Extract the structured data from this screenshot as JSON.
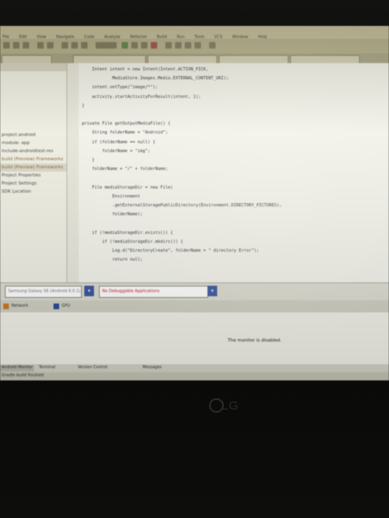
{
  "device": {
    "brand": "LG"
  },
  "ide": {
    "menu": [
      "File",
      "Edit",
      "View",
      "Navigate",
      "Code",
      "Analyze",
      "Refactor",
      "Build",
      "Run",
      "Tools",
      "VCS",
      "Window",
      "Help"
    ],
    "project_tree": [
      "project.android",
      "module: app",
      "include-androidtest-res",
      "build (Preview) Frameworks",
      "build (Preview) Frameworks",
      "Project Properties",
      "Project Settings",
      "SDK Location"
    ],
    "code_lines": [
      "    Intent intent = new Intent(Intent.ACTION_PICK,",
      "            MediaStore.Images.Media.EXTERNAL_CONTENT_URI);",
      "    intent.setType(\"image/*\");",
      "    activity.startActivityForResult(intent, 1);",
      "}",
      "",
      "private File getOutputMediaFile() {",
      "    String folderName = \"Android\";",
      "    if (folderName == null) {",
      "        folderName = \"img\";",
      "    }",
      "    folderName = \"/\" + folderName;",
      "",
      "    File mediaStorageDir = new File(",
      "            Environment",
      "            .getExternalStoragePublicDirectory(Environment.DIRECTORY_PICTURES),",
      "            folderName);",
      "",
      "    if (!mediaStorageDir.exists()) {",
      "        if (!mediaStorageDir.mkdirs()) {",
      "            Log.d(\"DirectoryCreate\", folderName + \" directory Error\");",
      "            return null;"
    ],
    "device_selector": "Samsung Galaxy S6 (Android 6.0.1)",
    "app_selector": "No Debuggable Applications",
    "monitor_tabs": [
      "Network",
      "GPU"
    ],
    "monitor_message": "The monitor is disabled.",
    "tool_tabs": [
      "Android Monitor",
      "Terminal",
      "Version Control",
      "Messages"
    ],
    "status": "Gradle build finished"
  },
  "taskbar": {
    "apps": [
      "chrome-icon",
      "firefox-icon",
      "skype-icon",
      "media-player-icon",
      "file-explorer-icon",
      "android-studio-icon",
      "download-icon"
    ]
  },
  "colors": {
    "taskbar": "#2a5590",
    "editor_bg": "#f2f2ea",
    "highlight": "#e0e040",
    "error_text": "#d02020"
  }
}
